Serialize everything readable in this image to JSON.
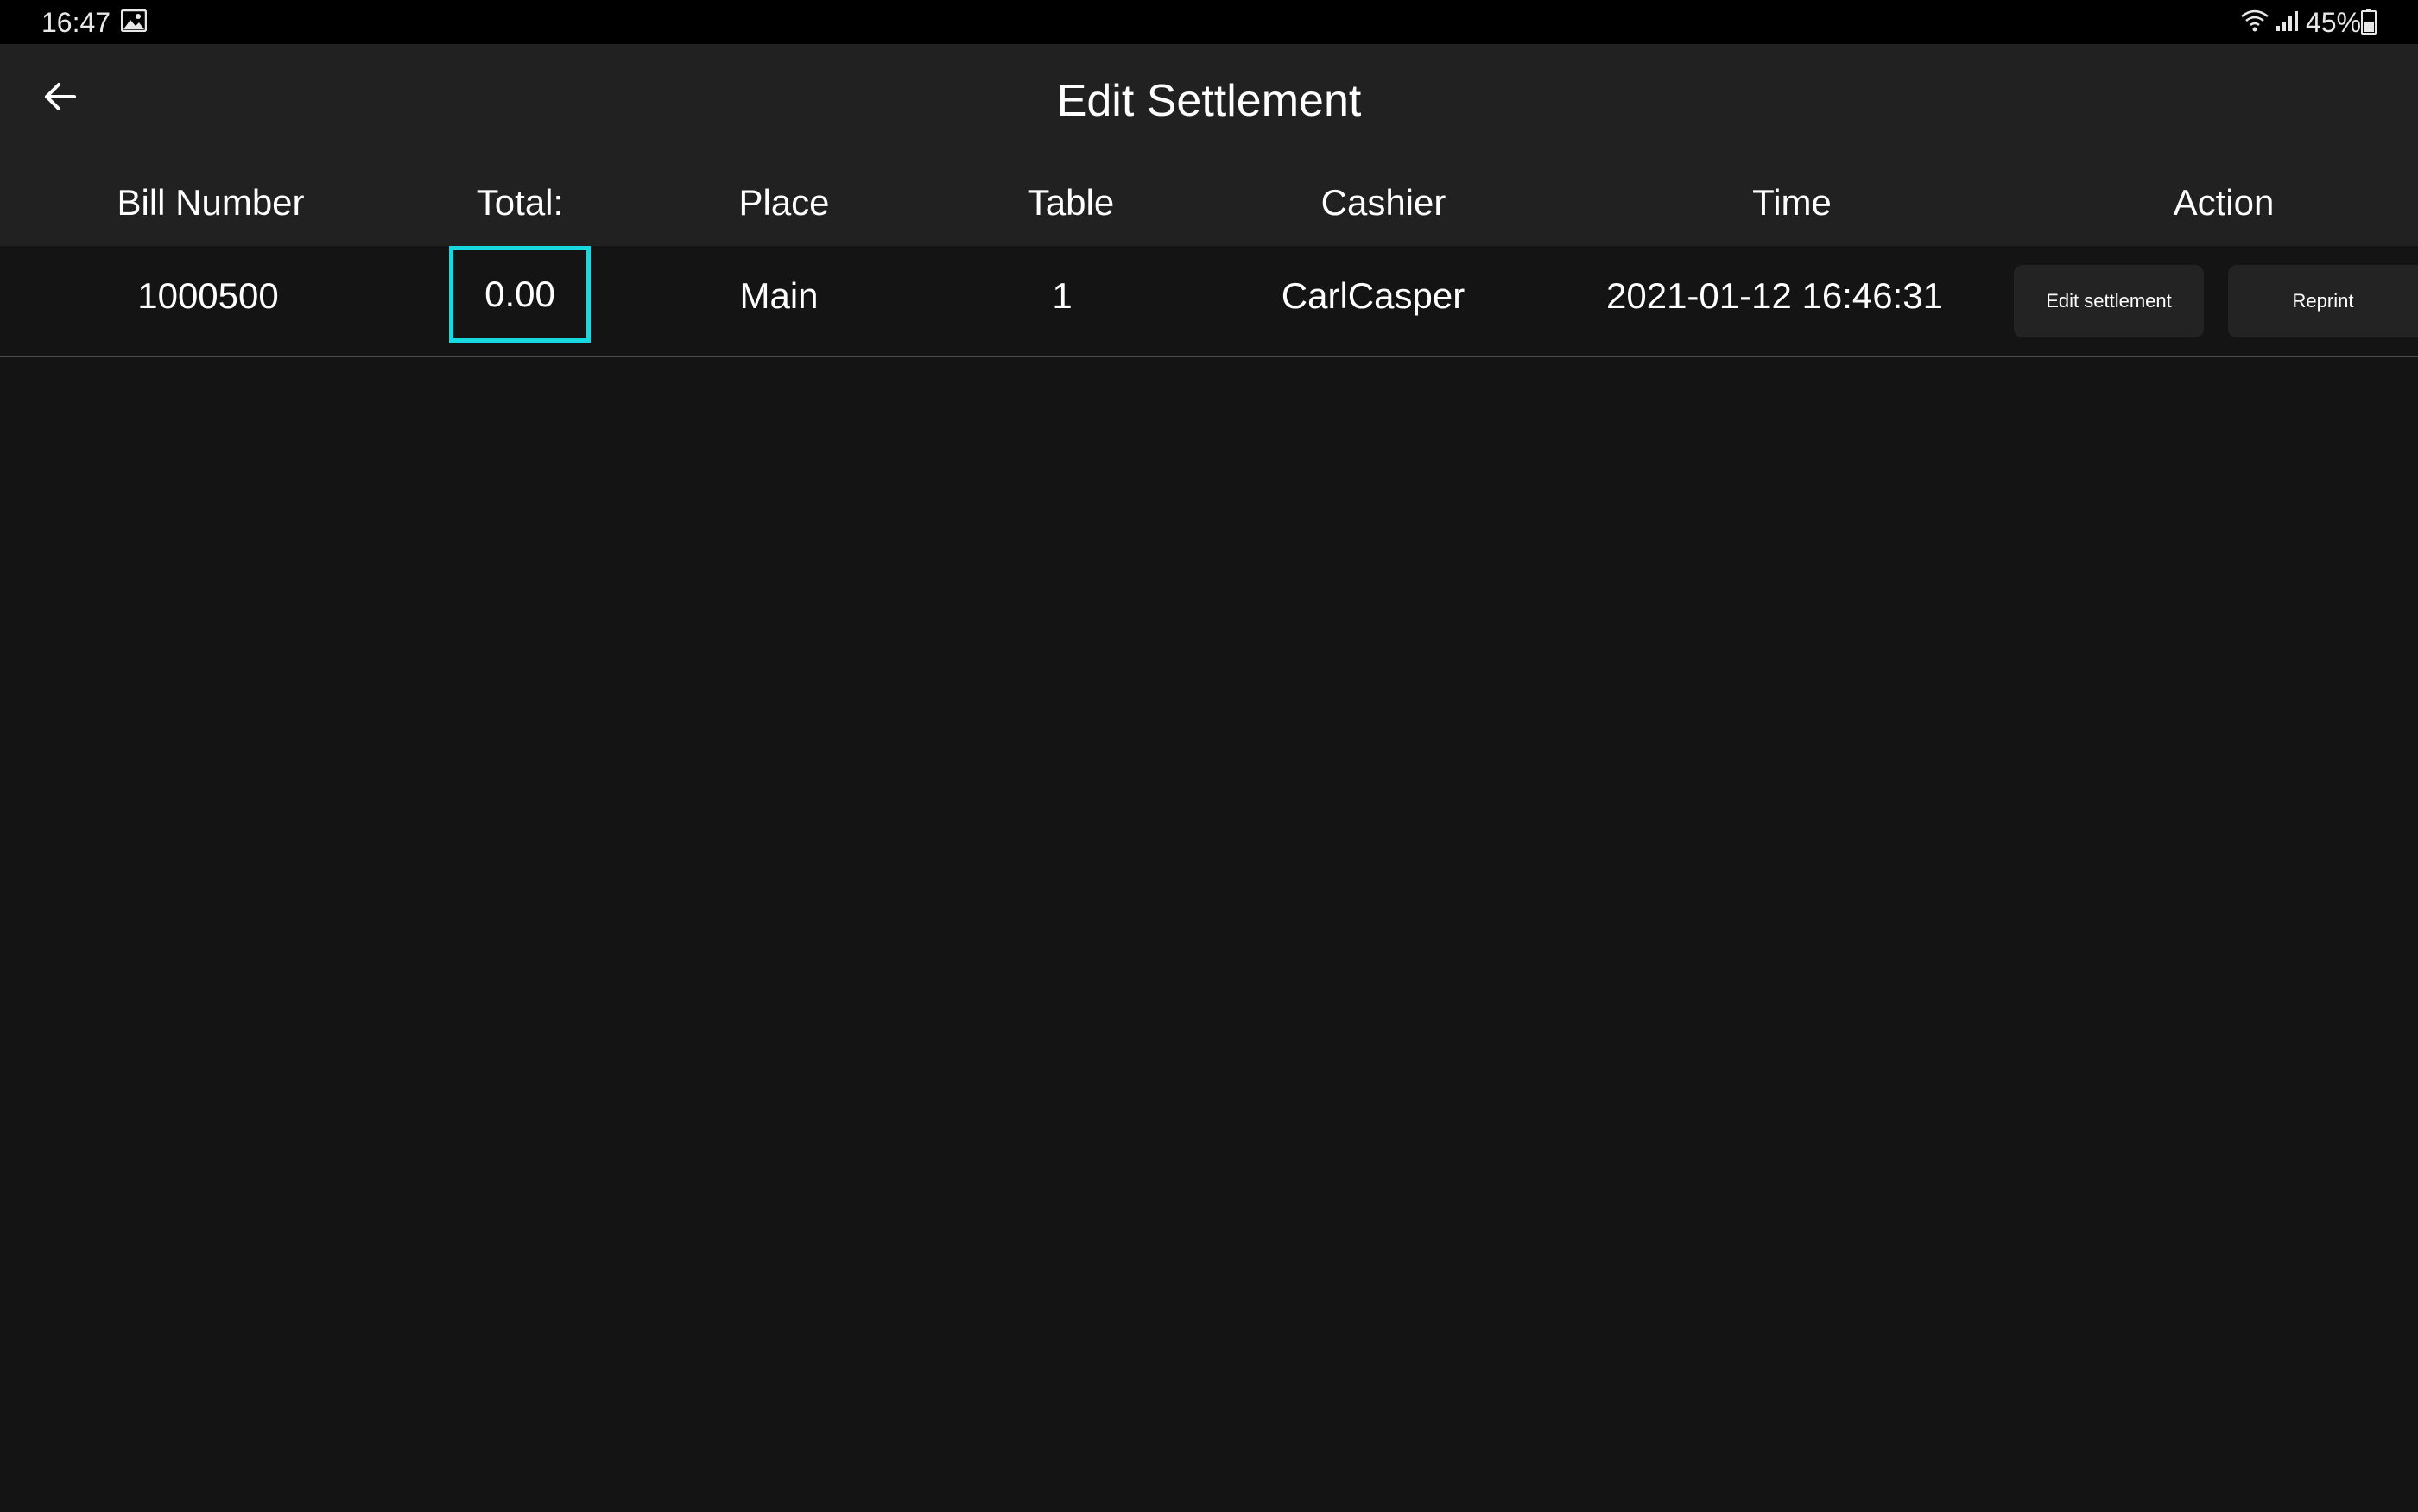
{
  "status_bar": {
    "time": "16:47",
    "battery": "45%",
    "icons": [
      "gallery-icon",
      "wifi-icon",
      "signal-icon",
      "battery-icon"
    ]
  },
  "app_bar": {
    "title": "Edit Settlement",
    "back_icon": "arrow-left-icon"
  },
  "table": {
    "headers": {
      "bill_number": "Bill Number",
      "total": "Total:",
      "place": "Place",
      "table": "Table",
      "cashier": "Cashier",
      "time": "Time",
      "action": "Action"
    },
    "rows": [
      {
        "bill_number": "1000500",
        "total": "0.00",
        "place": "Main",
        "table": "1",
        "cashier": "CarlCasper",
        "time": "2021-01-12 16:46:31",
        "actions": {
          "edit": "Edit settlement",
          "reprint": "Reprint"
        }
      }
    ]
  },
  "colors": {
    "background": "#141414",
    "app_bar": "#212121",
    "status_bar": "#000000",
    "highlight": "#19d9e0",
    "button": "#232323"
  }
}
